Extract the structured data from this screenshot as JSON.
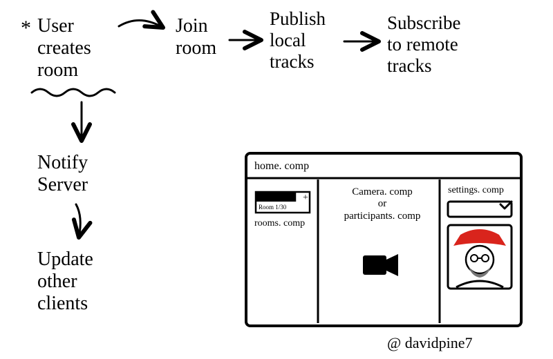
{
  "flow": {
    "step1": "User\ncreates\nroom",
    "step2": "Join\nroom",
    "step3": "Publish\nlocal\ntracks",
    "step4": "Subscribe\nto remote\ntracks",
    "down1": "Notify\nServer",
    "down2": "Update\nother\nclients"
  },
  "comp": {
    "home": "home. comp",
    "rooms_label": "rooms. comp",
    "room_name": "Room 1/30",
    "center": "Camera. comp\nor\nparticipants. comp",
    "settings": "settings. comp"
  },
  "credit": "@ davidpine7"
}
